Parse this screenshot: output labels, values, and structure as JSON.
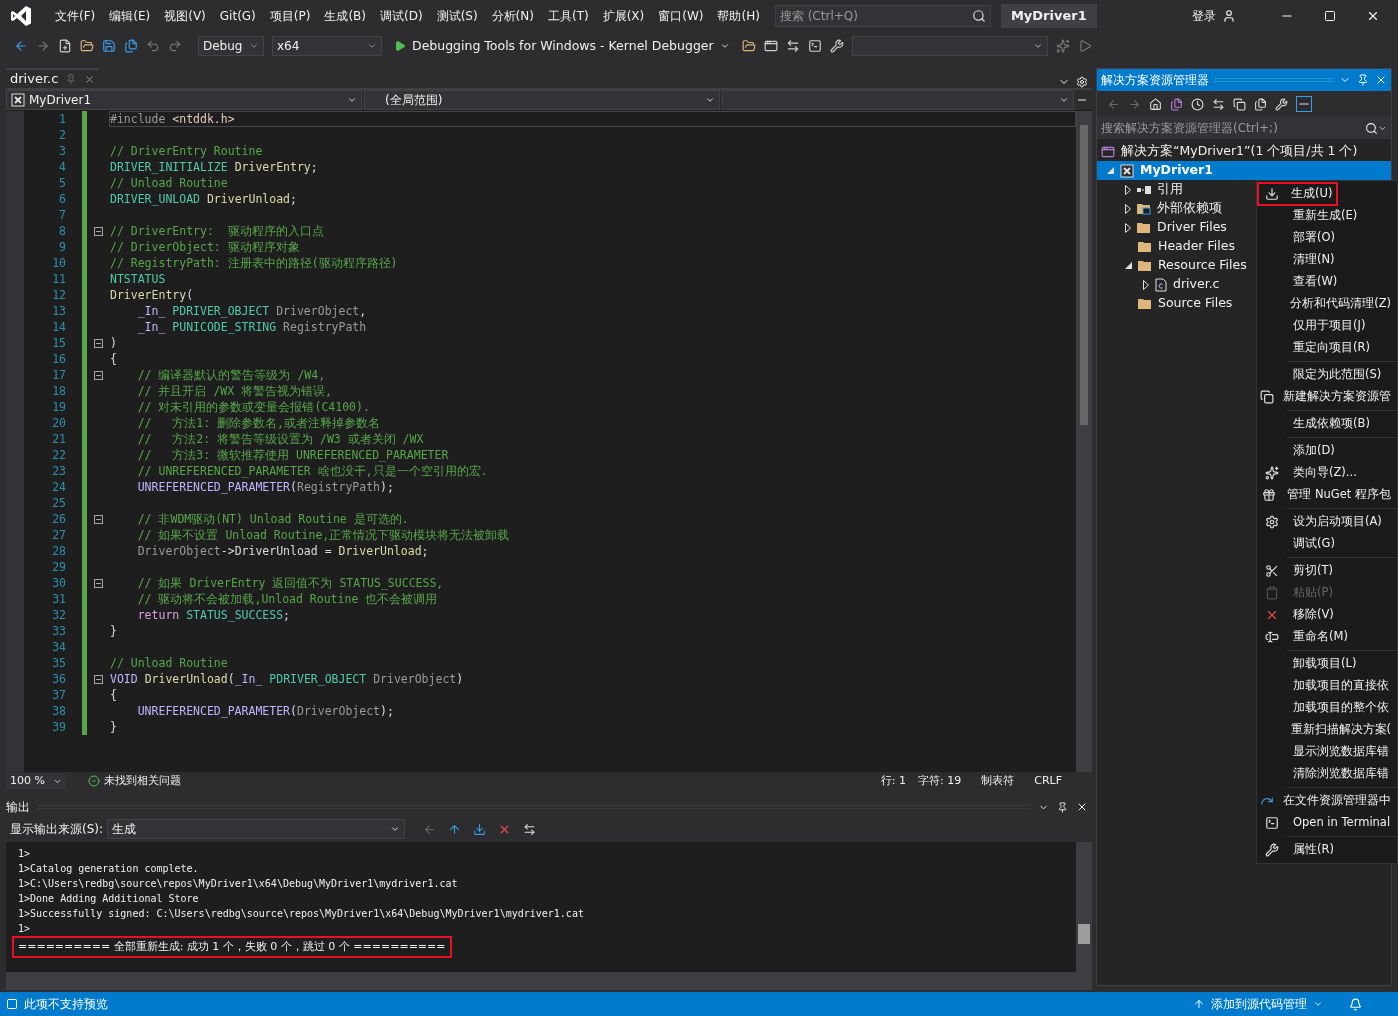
{
  "menu_bar": {
    "items": [
      "文件(F)",
      "编辑(E)",
      "视图(V)",
      "Git(G)",
      "项目(P)",
      "生成(B)",
      "调试(D)",
      "测试(S)",
      "分析(N)",
      "工具(T)",
      "扩展(X)",
      "窗口(W)",
      "帮助(H)"
    ],
    "search": {
      "placeholder": "搜索 (Ctrl+Q)"
    },
    "title": "MyDriver1",
    "sign_in": "登录"
  },
  "toolbar": {
    "configuration": "Debug",
    "platform": "x64",
    "debugger": "Debugging Tools for Windows - Kernel Debugger"
  },
  "document_tabs": [
    {
      "label": "driver.c",
      "selected": true
    }
  ],
  "navigation_bar": {
    "project": "MyDriver1",
    "scope": "(全局范围)"
  },
  "editor": {
    "lines": [
      {
        "n": "1",
        "fold": false,
        "current": true,
        "tokens": [
          {
            "text": "#include ",
            "kind": "preproc"
          },
          {
            "text": "<ntddk.h>",
            "kind": "string"
          }
        ]
      },
      {
        "n": "2",
        "fold": false,
        "current": false
      },
      {
        "n": "3",
        "fold": false,
        "current": false,
        "tokens": [
          {
            "text": "// DriverEntry Routine",
            "kind": "comment"
          }
        ]
      },
      {
        "n": "4",
        "fold": false,
        "current": false,
        "tokens": [
          {
            "text": "DRIVER_INITIALIZE ",
            "kind": "type"
          },
          {
            "text": "DriverEntry",
            "kind": "func"
          },
          {
            "text": ";",
            "kind": "plain"
          }
        ]
      },
      {
        "n": "5",
        "fold": false,
        "current": false,
        "tokens": [
          {
            "text": "// Unload Routine",
            "kind": "comment"
          }
        ]
      },
      {
        "n": "6",
        "fold": false,
        "current": false,
        "tokens": [
          {
            "text": "DRIVER_UNLOAD ",
            "kind": "type"
          },
          {
            "text": "DriverUnload",
            "kind": "func"
          },
          {
            "text": ";",
            "kind": "plain"
          }
        ]
      },
      {
        "n": "7",
        "fold": false,
        "current": false
      },
      {
        "n": "8",
        "fold": true,
        "current": false,
        "tokens": [
          {
            "text": "// DriverEntry:  驱动程序的入口点",
            "kind": "comment"
          }
        ]
      },
      {
        "n": "9",
        "fold": false,
        "current": false,
        "tokens": [
          {
            "text": "// DriverObject: 驱动程序对象",
            "kind": "comment"
          }
        ]
      },
      {
        "n": "10",
        "fold": false,
        "current": false,
        "tokens": [
          {
            "text": "// RegistryPath: 注册表中的路径(驱动程序路径)",
            "kind": "comment"
          }
        ]
      },
      {
        "n": "11",
        "fold": false,
        "current": false,
        "tokens": [
          {
            "text": "NTSTATUS",
            "kind": "type"
          }
        ]
      },
      {
        "n": "12",
        "fold": false,
        "current": false,
        "tokens": [
          {
            "text": "DriverEntry",
            "kind": "func"
          },
          {
            "text": "(",
            "kind": "plain"
          }
        ]
      },
      {
        "n": "13",
        "fold": false,
        "current": false,
        "tokens": [
          {
            "text": "    _In_ ",
            "kind": "macro"
          },
          {
            "text": "PDRIVER_OBJECT ",
            "kind": "type"
          },
          {
            "text": "DriverObject",
            "kind": "param"
          },
          {
            "text": ",",
            "kind": "plain"
          }
        ]
      },
      {
        "n": "14",
        "fold": false,
        "current": false,
        "tokens": [
          {
            "text": "    _In_ ",
            "kind": "macro"
          },
          {
            "text": "PUNICODE_STRING ",
            "kind": "type"
          },
          {
            "text": "RegistryPath",
            "kind": "param"
          }
        ]
      },
      {
        "n": "15",
        "fold": true,
        "current": false,
        "tokens": [
          {
            "text": ")",
            "kind": "plain"
          }
        ]
      },
      {
        "n": "16",
        "fold": false,
        "current": false,
        "tokens": [
          {
            "text": "{",
            "kind": "plain"
          }
        ]
      },
      {
        "n": "17",
        "fold": true,
        "current": false,
        "tokens": [
          {
            "text": "    // 编译器默认的警告等级为 /W4,",
            "kind": "comment"
          }
        ]
      },
      {
        "n": "18",
        "fold": false,
        "current": false,
        "tokens": [
          {
            "text": "    // 并且开启 /WX 将警告视为错误,",
            "kind": "comment"
          }
        ]
      },
      {
        "n": "19",
        "fold": false,
        "current": false,
        "tokens": [
          {
            "text": "    // 对未引用的参数或变量会报错(C4100).",
            "kind": "comment"
          }
        ]
      },
      {
        "n": "20",
        "fold": false,
        "current": false,
        "tokens": [
          {
            "text": "    //   方法1: 删除参数名,或者注释掉参数名",
            "kind": "comment"
          }
        ]
      },
      {
        "n": "21",
        "fold": false,
        "current": false,
        "tokens": [
          {
            "text": "    //   方法2: 将警告等级设置为 /W3 或者关闭 /WX",
            "kind": "comment"
          }
        ]
      },
      {
        "n": "22",
        "fold": false,
        "current": false,
        "tokens": [
          {
            "text": "    //   方法3: 微软推荐使用 UNREFERENCED_PARAMETER",
            "kind": "comment"
          }
        ]
      },
      {
        "n": "23",
        "fold": false,
        "current": false,
        "tokens": [
          {
            "text": "    // UNREFERENCED_PARAMETER 啥也没干,只是一个空引用的宏.",
            "kind": "comment"
          }
        ]
      },
      {
        "n": "24",
        "fold": false,
        "current": false,
        "tokens": [
          {
            "text": "    UNREFERENCED_PARAMETER",
            "kind": "macro"
          },
          {
            "text": "(",
            "kind": "plain"
          },
          {
            "text": "RegistryPath",
            "kind": "param"
          },
          {
            "text": ");",
            "kind": "plain"
          }
        ]
      },
      {
        "n": "25",
        "fold": false,
        "current": false
      },
      {
        "n": "26",
        "fold": true,
        "current": false,
        "tokens": [
          {
            "text": "    // 非WDM驱动(NT) Unload Routine 是可选的.",
            "kind": "comment"
          }
        ]
      },
      {
        "n": "27",
        "fold": false,
        "current": false,
        "tokens": [
          {
            "text": "    // 如果不设置 Unload Routine,正常情况下驱动模块将无法被卸载",
            "kind": "comment"
          }
        ]
      },
      {
        "n": "28",
        "fold": false,
        "current": false,
        "tokens": [
          {
            "text": "    DriverObject",
            "kind": "param"
          },
          {
            "text": "->DriverUnload = ",
            "kind": "plain"
          },
          {
            "text": "DriverUnload",
            "kind": "func"
          },
          {
            "text": ";",
            "kind": "plain"
          }
        ]
      },
      {
        "n": "29",
        "fold": false,
        "current": false
      },
      {
        "n": "30",
        "fold": true,
        "current": false,
        "tokens": [
          {
            "text": "    // 如果 DriverEntry 返回值不为 STATUS_SUCCESS,",
            "kind": "comment"
          }
        ]
      },
      {
        "n": "31",
        "fold": false,
        "current": false,
        "tokens": [
          {
            "text": "    // 驱动将不会被加载,Unload Routine 也不会被调用",
            "kind": "comment"
          }
        ]
      },
      {
        "n": "32",
        "fold": false,
        "current": false,
        "tokens": [
          {
            "text": "    return ",
            "kind": "keyword"
          },
          {
            "text": "STATUS_SUCCESS",
            "kind": "type"
          },
          {
            "text": ";",
            "kind": "plain"
          }
        ]
      },
      {
        "n": "33",
        "fold": false,
        "current": false,
        "tokens": [
          {
            "text": "}",
            "kind": "plain"
          }
        ]
      },
      {
        "n": "34",
        "fold": false,
        "current": false
      },
      {
        "n": "35",
        "fold": false,
        "current": false,
        "tokens": [
          {
            "text": "// Unload Routine",
            "kind": "comment"
          }
        ]
      },
      {
        "n": "36",
        "fold": true,
        "current": false,
        "tokens": [
          {
            "text": "VOID ",
            "kind": "macro"
          },
          {
            "text": "DriverUnload",
            "kind": "func"
          },
          {
            "text": "(",
            "kind": "plain"
          },
          {
            "text": "_In_ ",
            "kind": "macro"
          },
          {
            "text": "PDRIVER_OBJECT ",
            "kind": "type"
          },
          {
            "text": "DriverObject",
            "kind": "param"
          },
          {
            "text": ")",
            "kind": "plain"
          }
        ]
      },
      {
        "n": "37",
        "fold": false,
        "current": false,
        "tokens": [
          {
            "text": "{",
            "kind": "plain"
          }
        ]
      },
      {
        "n": "38",
        "fold": false,
        "current": false,
        "tokens": [
          {
            "text": "    UNREFERENCED_PARAMETER",
            "kind": "macro"
          },
          {
            "text": "(",
            "kind": "plain"
          },
          {
            "text": "DriverObject",
            "kind": "param"
          },
          {
            "text": ");",
            "kind": "plain"
          }
        ]
      },
      {
        "n": "39",
        "fold": false,
        "current": false,
        "tokens": [
          {
            "text": "}",
            "kind": "plain"
          }
        ]
      }
    ]
  },
  "editor_status": {
    "zoom": "100 %",
    "issues": "未找到相关问题",
    "line": "行: 1",
    "column": "字符: 19",
    "indent": "制表符",
    "line_ending": "CRLF"
  },
  "output": {
    "title": "输出",
    "source_label": "显示输出来源(S):",
    "source": "生成",
    "lines": [
      {
        "text": "1>",
        "highlighted": false
      },
      {
        "text": "1>Catalog generation complete.",
        "highlighted": false
      },
      {
        "text": "1>C:\\Users\\redbg\\source\\repos\\MyDriver1\\x64\\Debug\\MyDriver1\\mydriver1.cat",
        "highlighted": false
      },
      {
        "text": "1>Done Adding Additional Store",
        "highlighted": false
      },
      {
        "text": "1>Successfully signed: C:\\Users\\redbg\\source\\repos\\MyDriver1\\x64\\Debug\\MyDriver1\\mydriver1.cat",
        "highlighted": false
      },
      {
        "text": "1>",
        "highlighted": false
      },
      {
        "text": "========== 全部重新生成: 成功 1 个，失败 0 个，跳过 0 个 ==========",
        "highlighted": true
      }
    ]
  },
  "solution_explorer": {
    "title": "解决方案资源管理器",
    "search": {
      "placeholder": "搜索解决方案资源管理器(Ctrl+;)"
    },
    "tree": [
      {
        "label": "解决方案“MyDriver1”(1 个项目/共 1 个)",
        "kind": "solution",
        "selected": false,
        "children": [
          {
            "label": "MyDriver1",
            "kind": "project",
            "expanded": true,
            "selected": true,
            "children": [
              {
                "label": "引用",
                "kind": "references",
                "expanded": false,
                "selected": false
              },
              {
                "label": "外部依赖项",
                "kind": "external",
                "expanded": false,
                "selected": false
              },
              {
                "label": "Driver Files",
                "kind": "folder",
                "expanded": false,
                "selected": false
              },
              {
                "label": "Header Files",
                "kind": "folder",
                "selected": false
              },
              {
                "label": "Resource Files",
                "kind": "folder",
                "expanded": true,
                "selected": false,
                "children": [
                  {
                    "label": "driver.c",
                    "kind": "file",
                    "expanded": false,
                    "selected": false
                  }
                ]
              },
              {
                "label": "Source Files",
                "kind": "folder",
                "selected": false
              }
            ]
          }
        ]
      }
    ]
  },
  "context_menu": {
    "items": [
      {
        "kind": "item",
        "label": "生成(U)",
        "disabled": false,
        "highlighted": true
      },
      {
        "kind": "item",
        "label": "重新生成(E)",
        "disabled": false,
        "highlighted": false
      },
      {
        "kind": "item",
        "label": "部署(O)",
        "disabled": false,
        "highlighted": false
      },
      {
        "kind": "item",
        "label": "清理(N)",
        "disabled": false,
        "highlighted": false
      },
      {
        "kind": "item",
        "label": "查看(W)",
        "disabled": false,
        "highlighted": false
      },
      {
        "kind": "item",
        "label": "分析和代码清理(Z)",
        "disabled": false,
        "highlighted": false
      },
      {
        "kind": "item",
        "label": "仅用于项目(J)",
        "disabled": false,
        "highlighted": false
      },
      {
        "kind": "item",
        "label": "重定向项目(R)",
        "disabled": false,
        "highlighted": false
      },
      {
        "kind": "separator"
      },
      {
        "kind": "item",
        "label": "限定为此范围(S)",
        "disabled": false,
        "highlighted": false
      },
      {
        "kind": "item",
        "label": "新建解决方案资源管",
        "disabled": false,
        "highlighted": false
      },
      {
        "kind": "separator"
      },
      {
        "kind": "item",
        "label": "生成依赖项(B)",
        "disabled": false,
        "highlighted": false
      },
      {
        "kind": "separator"
      },
      {
        "kind": "item",
        "label": "添加(D)",
        "disabled": false,
        "highlighted": false
      },
      {
        "kind": "item",
        "label": "类向导(Z)...",
        "disabled": false,
        "highlighted": false
      },
      {
        "kind": "item",
        "label": "管理 NuGet 程序包",
        "disabled": false,
        "highlighted": false
      },
      {
        "kind": "separator"
      },
      {
        "kind": "item",
        "label": "设为启动项目(A)",
        "disabled": false,
        "highlighted": false
      },
      {
        "kind": "item",
        "label": "调试(G)",
        "disabled": false,
        "highlighted": false
      },
      {
        "kind": "separator"
      },
      {
        "kind": "item",
        "label": "剪切(T)",
        "disabled": false,
        "highlighted": false
      },
      {
        "kind": "item",
        "label": "粘贴(P)",
        "disabled": true,
        "highlighted": false
      },
      {
        "kind": "item",
        "label": "移除(V)",
        "disabled": false,
        "highlighted": false
      },
      {
        "kind": "item",
        "label": "重命名(M)",
        "disabled": false,
        "highlighted": false
      },
      {
        "kind": "separator"
      },
      {
        "kind": "item",
        "label": "卸载项目(L)",
        "disabled": false,
        "highlighted": false
      },
      {
        "kind": "item",
        "label": "加载项目的直接依",
        "disabled": false,
        "highlighted": false
      },
      {
        "kind": "item",
        "label": "加载项目的整个依",
        "disabled": false,
        "highlighted": false
      },
      {
        "kind": "item",
        "label": "重新扫描解决方案(",
        "disabled": false,
        "highlighted": false
      },
      {
        "kind": "item",
        "label": "显示浏览数据库错",
        "disabled": false,
        "highlighted": false
      },
      {
        "kind": "item",
        "label": "清除浏览数据库错",
        "disabled": false,
        "highlighted": false
      },
      {
        "kind": "separator"
      },
      {
        "kind": "item",
        "label": "在文件资源管理器中",
        "disabled": false,
        "highlighted": false
      },
      {
        "kind": "item",
        "label": "Open in Terminal",
        "disabled": false,
        "highlighted": false
      },
      {
        "kind": "separator"
      },
      {
        "kind": "item",
        "label": "属性(R)",
        "disabled": false,
        "highlighted": false
      }
    ]
  },
  "status_bar": {
    "message": "此项不支持预览",
    "source_control": "添加到源代码管理"
  }
}
